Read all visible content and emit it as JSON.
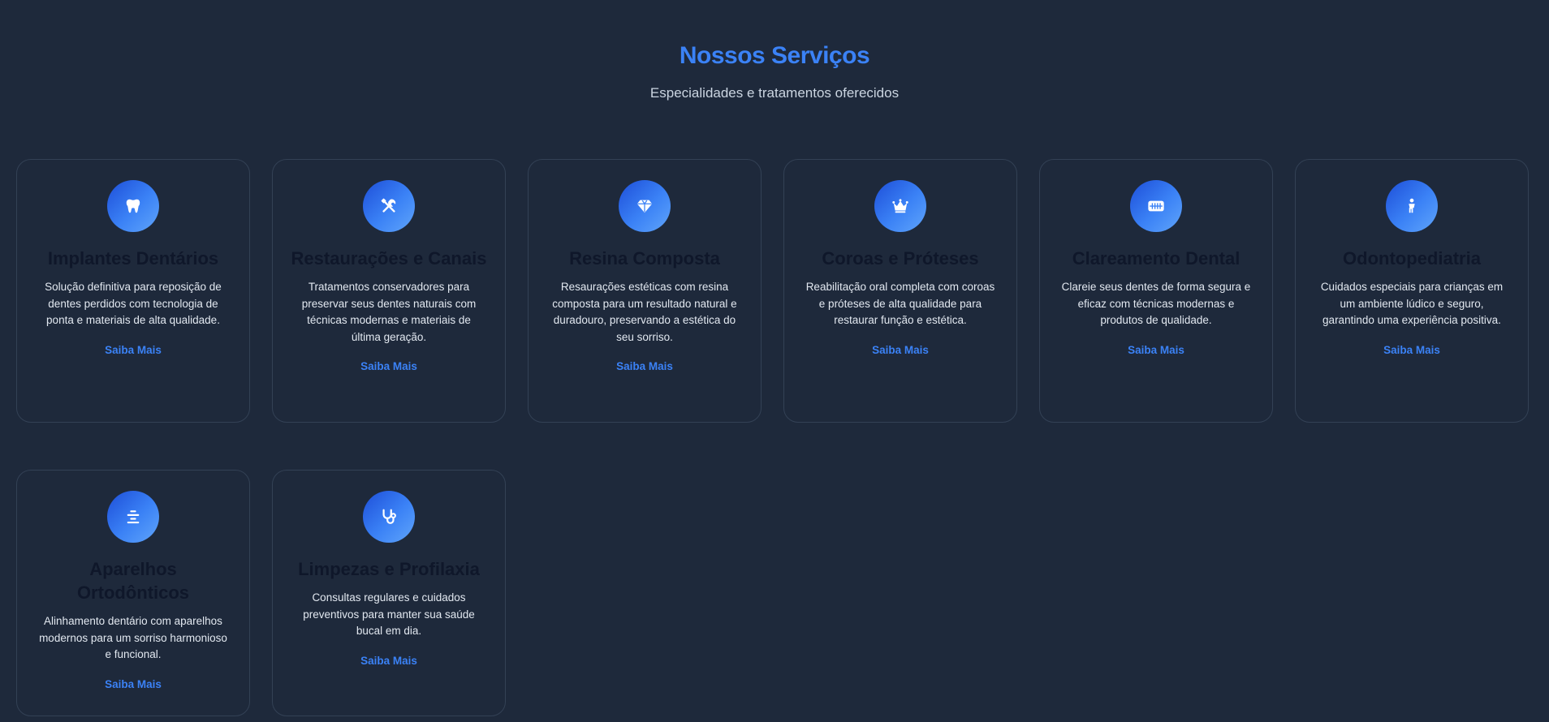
{
  "header": {
    "title": "Nossos Serviços",
    "subtitle": "Especialidades e tratamentos oferecidos"
  },
  "colors": {
    "background": "#1e293b",
    "accent": "#3b82f6",
    "card_border": "#334155",
    "card_title": "#0f172a"
  },
  "services": [
    {
      "icon": "tooth-icon",
      "title": "Implantes Dentários",
      "description": "Solução definitiva para reposição de dentes perdidos com tecnologia de ponta e materiais de alta qualidade.",
      "link": "Saiba Mais"
    },
    {
      "icon": "tools-icon",
      "title": "Restaurações e Canais",
      "description": "Tratamentos conservadores para preservar seus dentes naturais com técnicas modernas e materiais de última geração.",
      "link": "Saiba Mais"
    },
    {
      "icon": "gem-icon",
      "title": "Resina Composta",
      "description": "Resaurações estéticas com resina composta para um resultado natural e duradouro, preservando a estética do seu sorriso.",
      "link": "Saiba Mais"
    },
    {
      "icon": "crown-icon",
      "title": "Coroas e Próteses",
      "description": "Reabilitação oral completa com coroas e próteses de alta qualidade para restaurar função e estética.",
      "link": "Saiba Mais"
    },
    {
      "icon": "teeth-icon",
      "title": "Clareamento Dental",
      "description": "Clareie seus dentes de forma segura e eficaz com técnicas modernas e produtos de qualidade.",
      "link": "Saiba Mais"
    },
    {
      "icon": "child-icon",
      "title": "Odontopediatria",
      "description": "Cuidados especiais para crianças em um ambiente lúdico e seguro, garantindo uma experiência positiva.",
      "link": "Saiba Mais"
    },
    {
      "icon": "align-center-icon",
      "title": "Aparelhos Ortodônticos",
      "description": "Alinhamento dentário com aparelhos modernos para um sorriso harmonioso e funcional.",
      "link": "Saiba Mais"
    },
    {
      "icon": "stethoscope-icon",
      "title": "Limpezas e Profilaxia",
      "description": "Consultas regulares e cuidados preventivos para manter sua saúde bucal em dia.",
      "link": "Saiba Mais"
    }
  ]
}
